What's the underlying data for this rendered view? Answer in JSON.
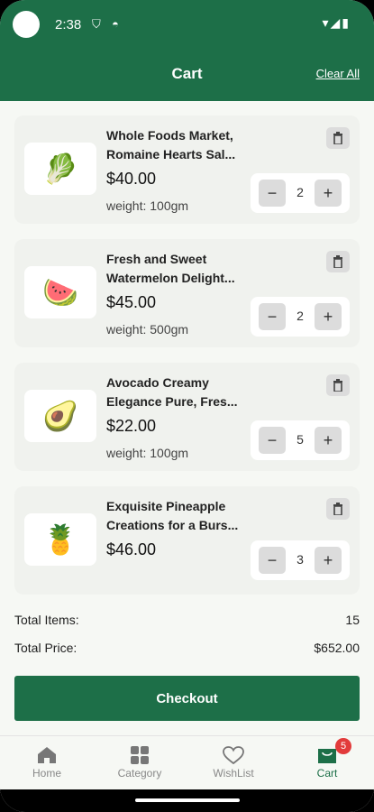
{
  "status_bar": {
    "time": "2:38"
  },
  "header": {
    "title": "Cart",
    "clear_all": "Clear All"
  },
  "cart_items": [
    {
      "title": "Whole Foods Market, Romaine Hearts Sal...",
      "price": "$40.00",
      "weight": "weight: 100gm",
      "qty": "2",
      "icon": "lettuce-icon",
      "emoji": "🥬"
    },
    {
      "title": "Fresh and Sweet Watermelon Delight...",
      "price": "$45.00",
      "weight": "weight: 500gm",
      "qty": "2",
      "icon": "watermelon-icon",
      "emoji": "🍉"
    },
    {
      "title": "Avocado Creamy Elegance Pure, Fres...",
      "price": "$22.00",
      "weight": "weight: 100gm",
      "qty": "5",
      "icon": "avocado-icon",
      "emoji": "🥑"
    },
    {
      "title": "Exquisite Pineapple Creations for a Burs...",
      "price": "$46.00",
      "weight": "",
      "qty": "3",
      "icon": "pineapple-icon",
      "emoji": "🍍"
    }
  ],
  "totals": {
    "items_label": "Total Items:",
    "items_value": "15",
    "price_label": "Total Price:",
    "price_value": "$652.00"
  },
  "checkout_label": "Checkout",
  "nav": {
    "home": "Home",
    "category": "Category",
    "wishlist": "WishList",
    "cart": "Cart",
    "cart_badge": "5"
  },
  "colors": {
    "primary": "#1d6f48",
    "badge": "#e23b3b"
  }
}
